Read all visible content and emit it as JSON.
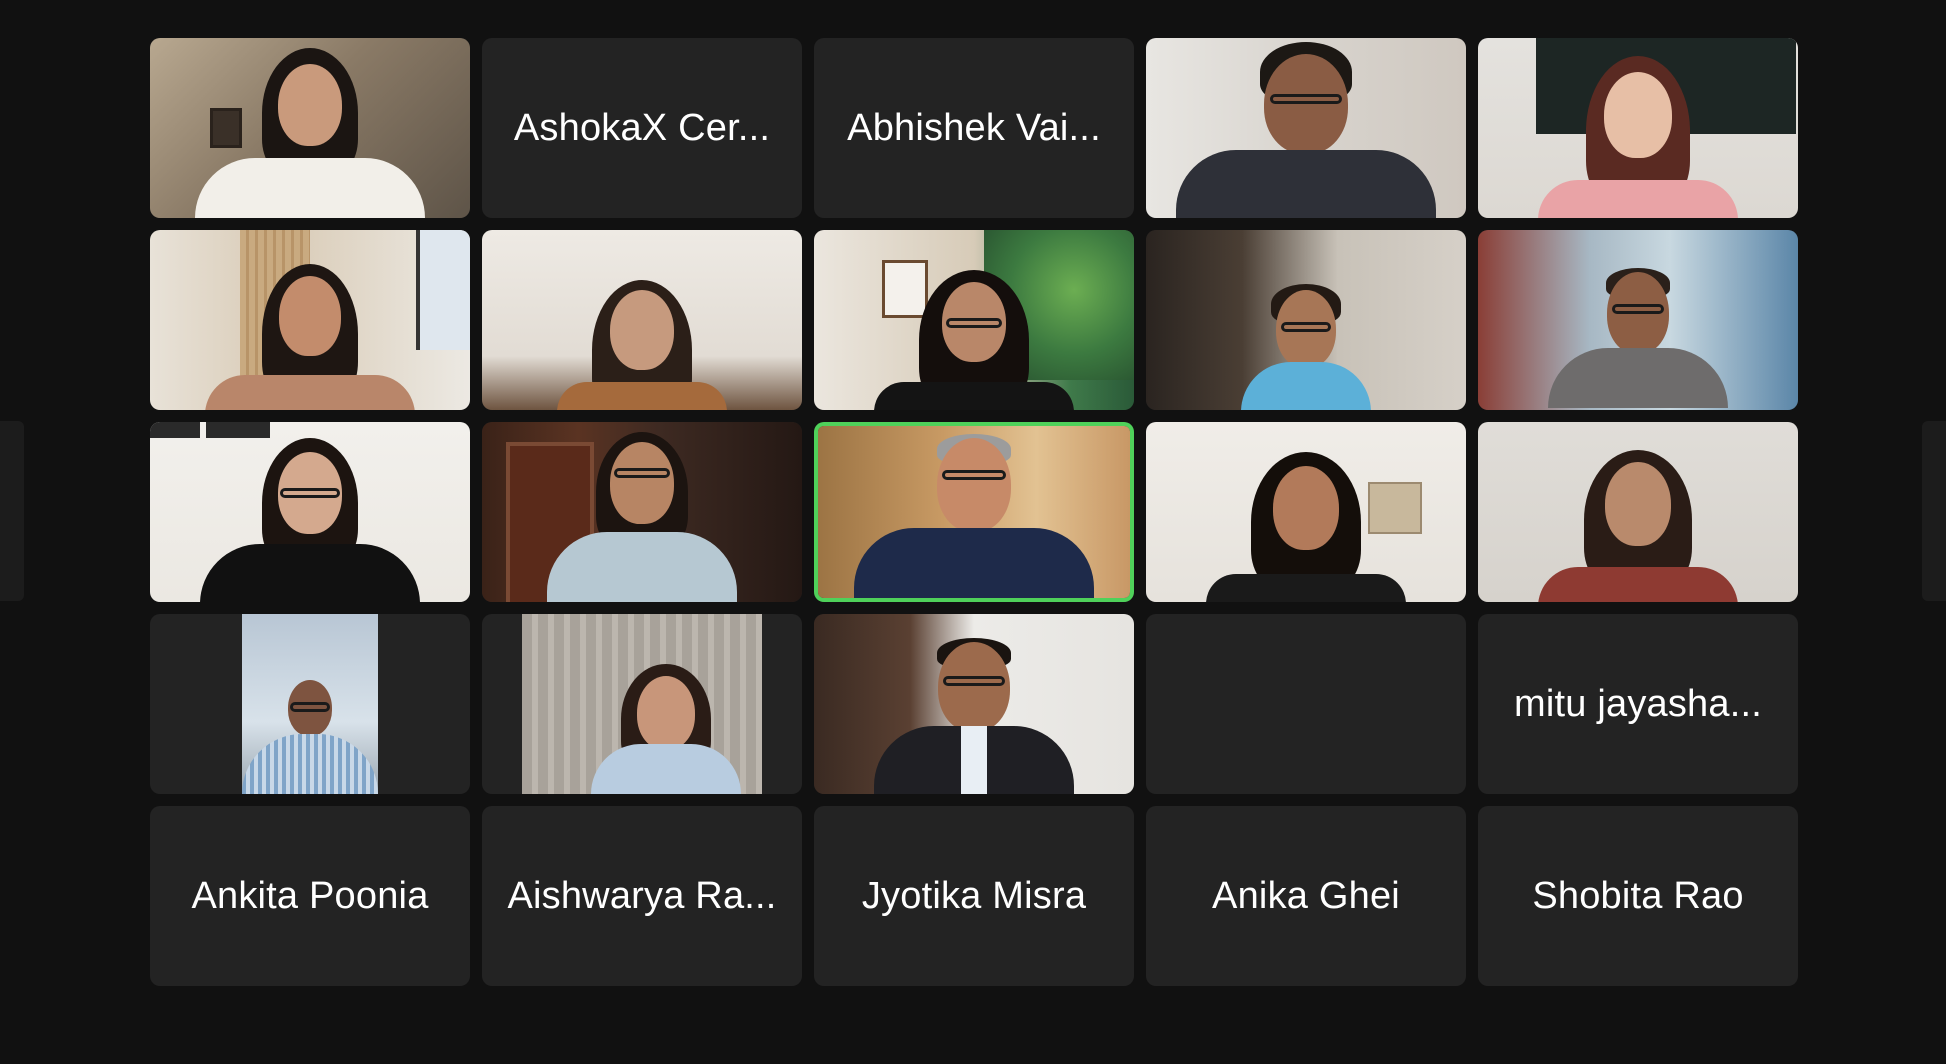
{
  "meeting": {
    "view": "gallery",
    "active_speaker_color": "#4fd15a"
  },
  "tiles": [
    {
      "name": "",
      "type": "video",
      "icon": "participant-video"
    },
    {
      "name": "AshokaX Cer...",
      "type": "name"
    },
    {
      "name": "Abhishek Vai...",
      "type": "name"
    },
    {
      "name": "",
      "type": "video",
      "icon": "participant-video"
    },
    {
      "name": "",
      "type": "video",
      "icon": "participant-video"
    },
    {
      "name": "",
      "type": "video",
      "icon": "participant-video"
    },
    {
      "name": "",
      "type": "video",
      "icon": "participant-video"
    },
    {
      "name": "",
      "type": "video",
      "icon": "participant-video"
    },
    {
      "name": "",
      "type": "video",
      "icon": "participant-video"
    },
    {
      "name": "",
      "type": "video",
      "icon": "participant-video"
    },
    {
      "name": "",
      "type": "video",
      "icon": "participant-video"
    },
    {
      "name": "",
      "type": "video",
      "icon": "participant-video"
    },
    {
      "name": "",
      "type": "video",
      "icon": "participant-video",
      "active_speaker": true
    },
    {
      "name": "",
      "type": "video",
      "icon": "participant-video"
    },
    {
      "name": "",
      "type": "video",
      "icon": "participant-video"
    },
    {
      "name": "",
      "type": "video",
      "icon": "participant-video"
    },
    {
      "name": "",
      "type": "video",
      "icon": "participant-video"
    },
    {
      "name": "",
      "type": "video",
      "icon": "participant-video"
    },
    {
      "name": "",
      "type": "empty"
    },
    {
      "name": "mitu jayasha...",
      "type": "name"
    },
    {
      "name": "Ankita Poonia",
      "type": "name"
    },
    {
      "name": "Aishwarya Ra...",
      "type": "name"
    },
    {
      "name": "Jyotika Misra",
      "type": "name"
    },
    {
      "name": "Anika Ghei",
      "type": "name"
    },
    {
      "name": "Shobita Rao",
      "type": "name"
    }
  ],
  "navigation": {
    "prev_page_icon": "chevron-left-icon",
    "next_page_icon": "chevron-right-icon"
  }
}
